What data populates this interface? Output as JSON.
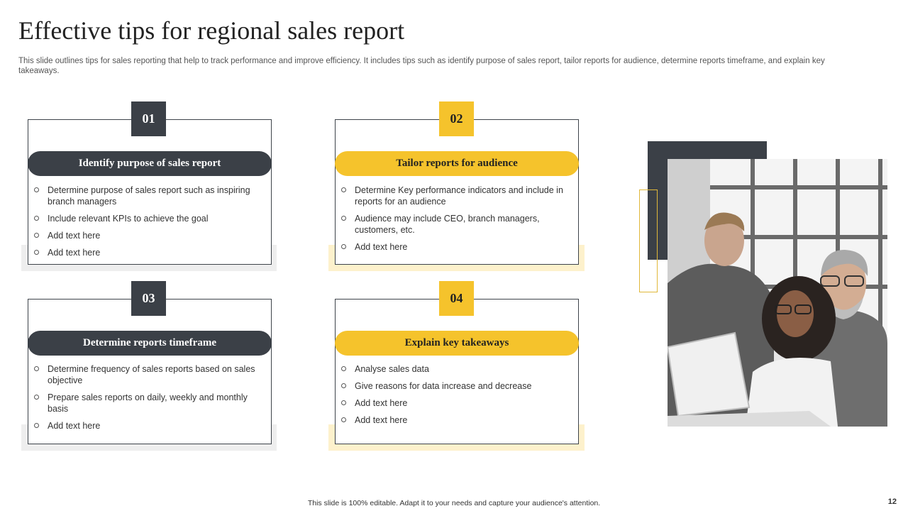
{
  "title": "Effective tips for regional sales report",
  "subtitle": "This slide outlines tips for sales reporting that help to track performance and improve efficiency. It includes tips such as identify purpose of sales report, tailor reports for audience, determine reports timeframe, and explain key takeaways.",
  "cards": [
    {
      "number": "01",
      "heading": "Identify purpose of sales report",
      "items": [
        "Determine purpose of sales report such as inspiring branch managers",
        "Include relevant KPIs to achieve the goal",
        "Add text here",
        "Add text here"
      ]
    },
    {
      "number": "02",
      "heading": "Tailor reports for audience",
      "items": [
        "Determine Key performance indicators and include in reports for an audience",
        "Audience may include CEO, branch managers, customers, etc.",
        "Add text here"
      ]
    },
    {
      "number": "03",
      "heading": "Determine reports timeframe",
      "items": [
        "Determine frequency of sales reports based on sales objective",
        "Prepare sales reports on daily, weekly and monthly basis",
        "Add text here"
      ]
    },
    {
      "number": "04",
      "heading": "Explain key takeaways",
      "items": [
        "Analyse sales data",
        "Give reasons for data increase and decrease",
        "Add text here",
        "Add text here"
      ]
    }
  ],
  "colors": {
    "dark": "#3b4047",
    "gold": "#f5c32c"
  },
  "footer": "This slide is 100% editable. Adapt it to your needs and capture your audience's attention.",
  "page_number": "12"
}
